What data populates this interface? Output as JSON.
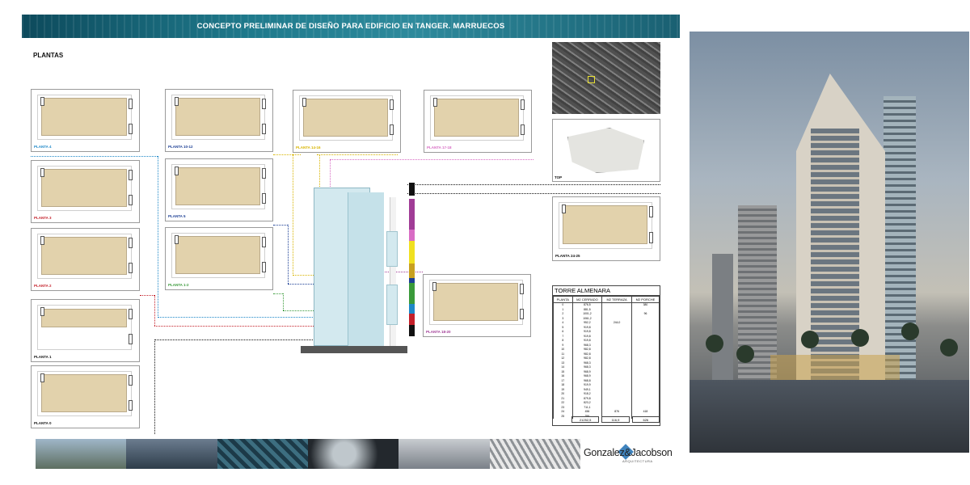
{
  "header": {
    "title": "CONCEPTO PRELIMINAR DE DISEÑO PARA EDIFICIO EN TANGER. MARRUECOS"
  },
  "section": {
    "title": "PLANTAS"
  },
  "plans": [
    {
      "label": "PLANTA 4",
      "color": "#1e88c8"
    },
    {
      "label": "PLANTA 3",
      "color": "#c4202a"
    },
    {
      "label": "PLANTA 2",
      "color": "#c4202a"
    },
    {
      "label": "PLANTA 1",
      "color": "#111111"
    },
    {
      "label": "PLANTA 0",
      "color": "#111111"
    },
    {
      "label": "PLANTA 10-12",
      "color": "#1c3f95"
    },
    {
      "label": "PLANTA 5",
      "color": "#1c3f95"
    },
    {
      "label": "PLANTA 1-2",
      "color": "#3a9a3a"
    },
    {
      "label": "PLANTA 14-16",
      "color": "#d8b400"
    },
    {
      "label": "PLANTA 17-18",
      "color": "#d86cc4"
    },
    {
      "label": "PLANTA 24-25",
      "color": "#111111"
    },
    {
      "label": "PLANTA 18-20",
      "color": "#a03c96"
    }
  ],
  "top_view": {
    "label": "TOP"
  },
  "table": {
    "title": "TORRE ALMENARA",
    "headers": [
      "PLANTA",
      "M2 CERRADO",
      "M2 TERRAZA",
      "M2 PORCHE"
    ],
    "rows": [
      [
        "0",
        "876,5",
        "",
        "380"
      ],
      [
        "1",
        "881,5",
        "",
        ""
      ],
      [
        "2",
        "1001,2",
        "",
        "96"
      ],
      [
        "3",
        "1061,2",
        "",
        ""
      ],
      [
        "4",
        "952,2",
        "244,0",
        ""
      ],
      [
        "5",
        "919,8",
        "",
        ""
      ],
      [
        "6",
        "919,8",
        "",
        ""
      ],
      [
        "7",
        "919,8",
        "",
        ""
      ],
      [
        "8",
        "919,8",
        "",
        ""
      ],
      [
        "9",
        "968,3",
        "",
        ""
      ],
      [
        "10",
        "982,8",
        "",
        ""
      ],
      [
        "11",
        "982,8",
        "",
        ""
      ],
      [
        "12",
        "982,8",
        "",
        ""
      ],
      [
        "13",
        "968,3",
        "",
        ""
      ],
      [
        "14",
        "968,3",
        "",
        ""
      ],
      [
        "15",
        "968,9",
        "",
        ""
      ],
      [
        "16",
        "968,9",
        "",
        ""
      ],
      [
        "17",
        "968,8",
        "",
        ""
      ],
      [
        "18",
        "919,9",
        "",
        ""
      ],
      [
        "19",
        "949,1",
        "",
        ""
      ],
      [
        "20",
        "918,2",
        "",
        ""
      ],
      [
        "21",
        "879,8",
        "",
        ""
      ],
      [
        "22",
        "823,2",
        "",
        ""
      ],
      [
        "23",
        "711,1",
        "",
        ""
      ],
      [
        "24",
        "456",
        "876",
        "418"
      ],
      [
        "25",
        "356",
        "",
        ""
      ]
    ],
    "totals": [
      "21252,5",
      "116,9",
      "626"
    ]
  },
  "color_bar": [
    "#111111",
    "#a03c96",
    "#d86cc4",
    "#f0e020",
    "#c8a020",
    "#1c3f95",
    "#3a9a3a",
    "#1e88c8",
    "#c4202a",
    "#111111"
  ],
  "logo": {
    "name": "Gonzalez&Jacobson",
    "sub": "ARQUITECTURA"
  }
}
